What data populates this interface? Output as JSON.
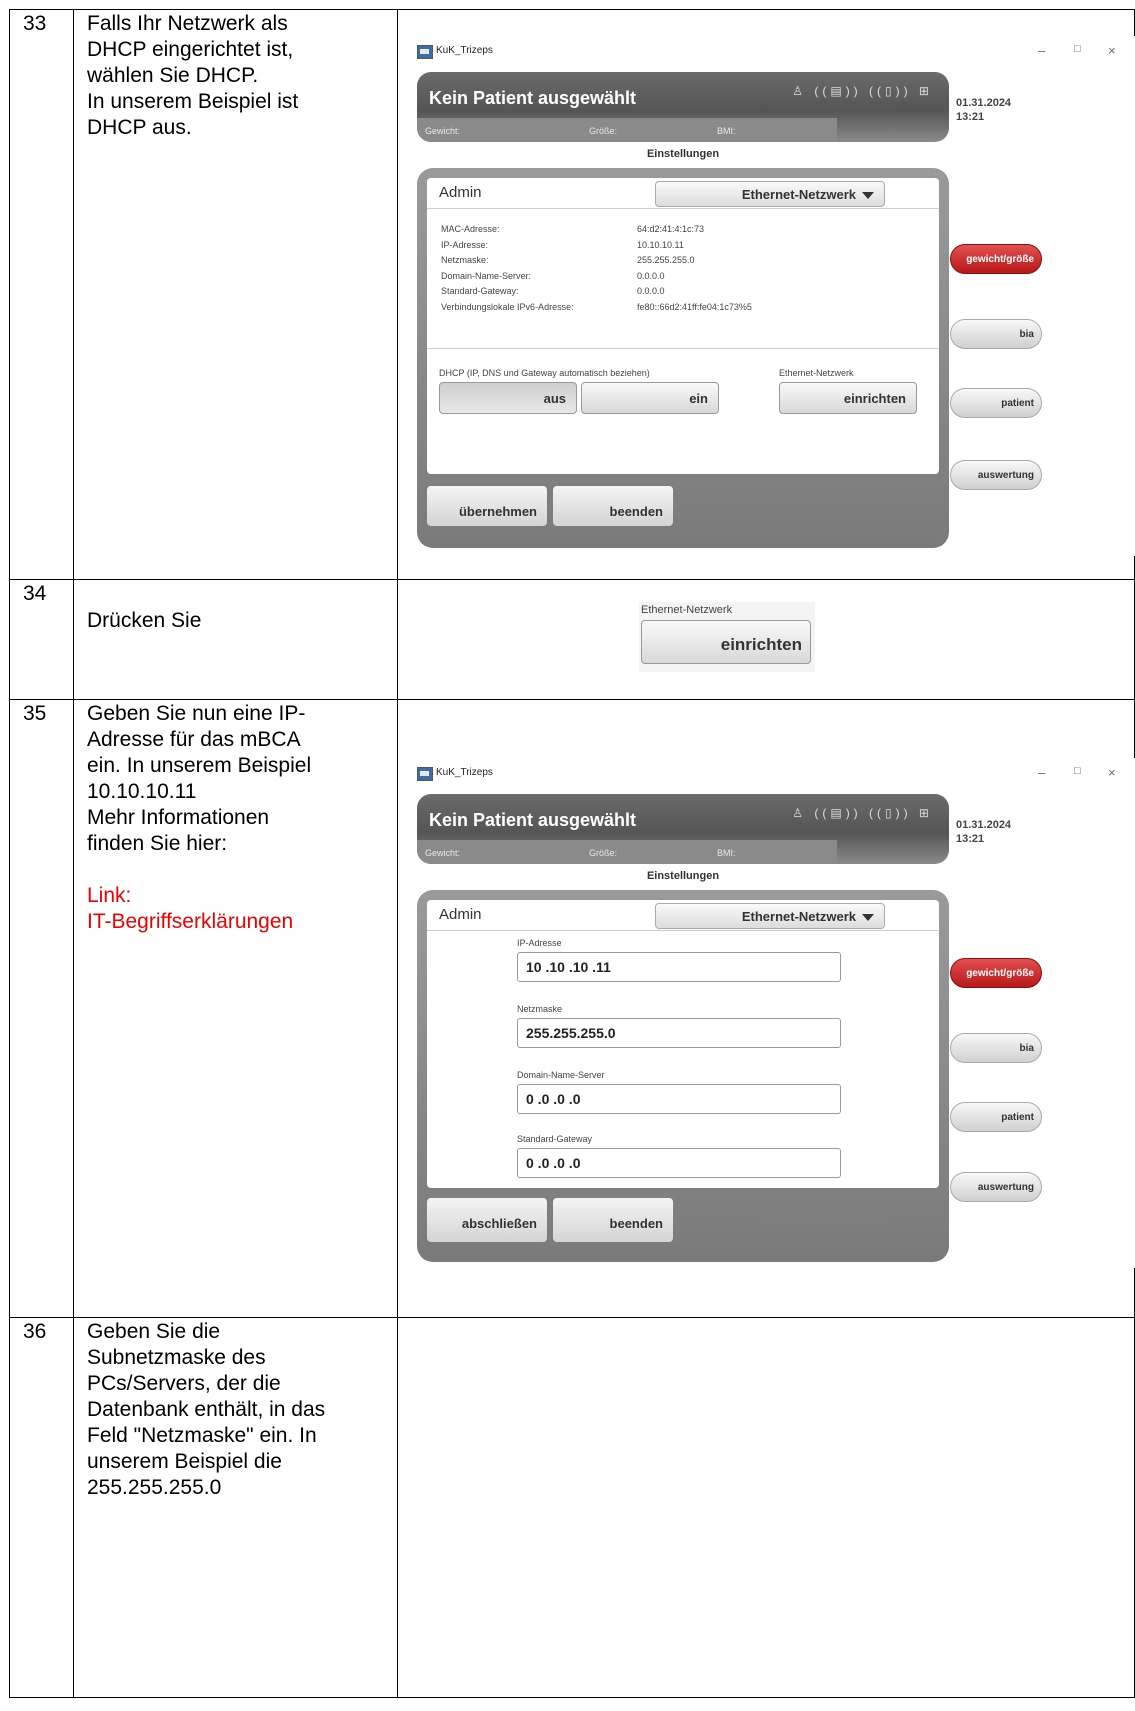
{
  "rows": [
    {
      "number": "33",
      "text": [
        "Falls Ihr Netzwerk als",
        "DHCP eingerichtet ist,",
        "wählen Sie DHCP.",
        "In unserem Beispiel ist",
        "DHCP aus."
      ]
    },
    {
      "number": "34",
      "text": [
        "Drücken Sie"
      ]
    },
    {
      "number": "35",
      "text": [
        "Geben Sie nun eine IP-",
        "Adresse für das mBCA",
        "ein. In unserem Beispiel",
        "10.10.10.11",
        "Mehr Informationen",
        "finden Sie hier:"
      ],
      "link_text": [
        "Link:",
        "IT-Begriffserklärungen"
      ]
    },
    {
      "number": "36",
      "text": [
        "Geben Sie die",
        "Subnetzmaske des",
        "PCs/Servers, der die",
        "Datenbank enthält, in das",
        "Feld \"Netzmaske\" ein. In",
        "unserem Beispiel die",
        "255.255.255.0"
      ]
    }
  ],
  "app": {
    "window_title": "KuK_Trizeps",
    "window_controls": {
      "minimize": "–",
      "maximize": "□",
      "close": "×"
    },
    "patient_title": "Kein Patient ausgewählt",
    "header_icons": "♙ ((▤)) ((▯)) ⊞",
    "stats": {
      "weight": "Gewicht:",
      "height": "Größe:",
      "bmi": "BMI:"
    },
    "date": "01.31.2024",
    "time": "13:21",
    "settings_label": "Einstellungen",
    "admin_label": "Admin",
    "dropdown_value": "Ethernet-Netzwerk",
    "side_buttons": [
      "gewicht/größe",
      "bia",
      "patient",
      "auswertung"
    ]
  },
  "screen33": {
    "info_labels": [
      "MAC-Adresse:",
      "IP-Adresse:",
      "Netzmaske:",
      "Domain-Name-Server:",
      "Standard-Gateway:",
      "Verbindungslokale IPv6-Adresse:"
    ],
    "info_values": [
      "64:d2:41:4:1c:73",
      "10.10.10.11",
      "255.255.255.0",
      "0.0.0.0",
      "0.0.0.0",
      "fe80::66d2:41ff:fe04:1c73%5"
    ],
    "dhcp_label": "DHCP (IP, DNS und Gateway automatisch beziehen)",
    "dhcp_off": "aus",
    "dhcp_on": "ein",
    "ethernet_label": "Ethernet-Netzwerk",
    "setup_button": "einrichten",
    "apply_button": "übernehmen",
    "quit_button": "beenden"
  },
  "screen34": {
    "ethernet_label": "Ethernet-Netzwerk",
    "setup_button": "einrichten"
  },
  "screen35": {
    "fields": [
      {
        "label": "IP-Adresse",
        "value": "10 .10 .10 .11"
      },
      {
        "label": "Netzmaske",
        "value": "255.255.255.0"
      },
      {
        "label": "Domain-Name-Server",
        "value": "0 .0 .0 .0"
      },
      {
        "label": "Standard-Gateway",
        "value": "0 .0 .0 .0"
      }
    ],
    "finish_button": "abschließen",
    "quit_button": "beenden"
  }
}
